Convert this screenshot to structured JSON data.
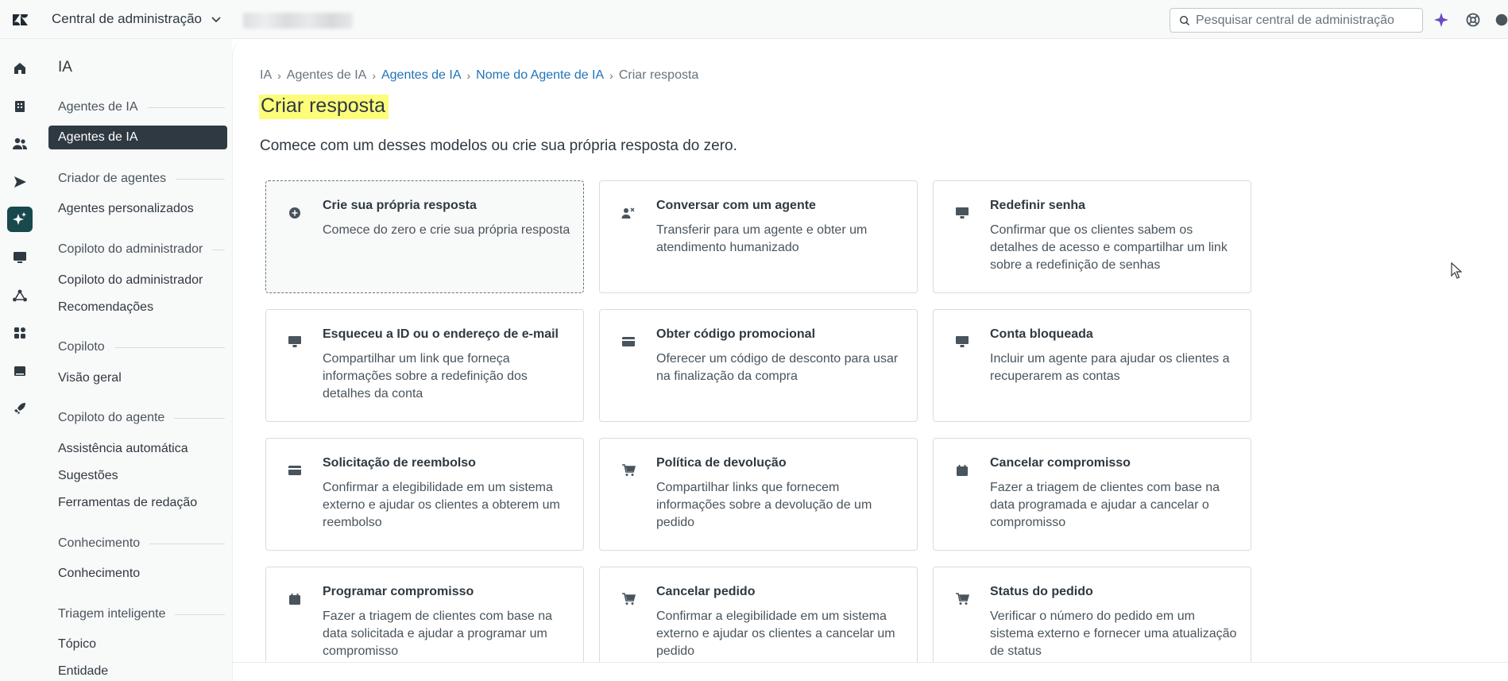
{
  "topbar": {
    "product_name": "Central de administração",
    "search_placeholder": "Pesquisar central de administração",
    "icons": [
      "zendesk-logo-icon",
      "chevron-down-icon",
      "search-icon",
      "sparkle-icon",
      "help-icon",
      "profile-icon"
    ]
  },
  "rail": {
    "icons": [
      "home-icon",
      "building-icon",
      "people-icon",
      "send-icon",
      "ai-sparkle-icon",
      "monitor-icon",
      "triangle-arrows-icon",
      "apps-icon",
      "server-icon",
      "rocket-icon"
    ]
  },
  "subnav": {
    "title": "IA",
    "sections": [
      {
        "label": "Agentes de IA",
        "items": [
          "Agentes de IA"
        ]
      },
      {
        "label": "Criador de agentes",
        "items": [
          "Agentes personalizados"
        ]
      },
      {
        "label": "Copiloto do administrador",
        "items": [
          "Copiloto do administrador",
          "Recomendações"
        ]
      },
      {
        "label": "Copiloto",
        "items": [
          "Visão geral"
        ]
      },
      {
        "label": "Copiloto do agente",
        "items": [
          "Assistência automática",
          "Sugestões",
          "Ferramentas de redação"
        ]
      },
      {
        "label": "Conhecimento",
        "items": [
          "Conhecimento"
        ]
      },
      {
        "label": "Triagem inteligente",
        "items": [
          "Tópico",
          "Entidade"
        ]
      }
    ]
  },
  "breadcrumb": [
    "IA",
    "Agentes de IA",
    "Agentes de IA",
    "Nome do Agente de IA",
    "Criar resposta"
  ],
  "page": {
    "title": "Criar resposta",
    "subtitle": "Comece com um desses modelos ou crie sua própria resposta do zero."
  },
  "cards": [
    {
      "title": "Crie sua própria resposta",
      "desc": "Comece do zero e crie sua própria resposta",
      "icon": "plus-circle-icon"
    },
    {
      "title": "Conversar com um agente",
      "desc": "Transferir para um agente e obter um atendimento humanizado",
      "icon": "agent-transfer-icon"
    },
    {
      "title": "Redefinir senha",
      "desc": "Confirmar que os clientes sabem os detalhes de acesso e compartilhar um link sobre a redefinição de senhas",
      "icon": "monitor-icon"
    },
    {
      "title": "Esqueceu a ID ou o endereço de e-mail",
      "desc": "Compartilhar um link que forneça informações sobre a redefinição dos detalhes da conta",
      "icon": "monitor-icon"
    },
    {
      "title": "Obter código promocional",
      "desc": "Oferecer um código de desconto para usar na finalização da compra",
      "icon": "credit-card-icon"
    },
    {
      "title": "Conta bloqueada",
      "desc": "Incluir um agente para ajudar os clientes a recuperarem as contas",
      "icon": "monitor-icon"
    },
    {
      "title": "Solicitação de reembolso",
      "desc": "Confirmar a elegibilidade em um sistema externo e ajudar os clientes a obterem um reembolso",
      "icon": "credit-card-icon"
    },
    {
      "title": "Política de devolução",
      "desc": "Compartilhar links que fornecem informações sobre a devolução de um pedido",
      "icon": "cart-icon"
    },
    {
      "title": "Cancelar compromisso",
      "desc": "Fazer a triagem de clientes com base na data programada e ajudar a cancelar o compromisso",
      "icon": "calendar-icon"
    },
    {
      "title": "Programar compromisso",
      "desc": "Fazer a triagem de clientes com base na data solicitada e ajudar a programar um compromisso",
      "icon": "calendar-icon"
    },
    {
      "title": "Cancelar pedido",
      "desc": "Confirmar a elegibilidade em um sistema externo e ajudar os clientes a cancelar um pedido",
      "icon": "cart-icon"
    },
    {
      "title": "Status do pedido",
      "desc": "Verificar o número do pedido em um sistema externo e fornecer uma atualização de status",
      "icon": "cart-icon"
    }
  ],
  "colors": {
    "link": "#1f73b7",
    "text": "#2f3941",
    "selected_nav": "#2f3941",
    "active_rail": "#17494d",
    "highlight": "#fdfd7a",
    "sparkle": "#6a4bc4"
  }
}
